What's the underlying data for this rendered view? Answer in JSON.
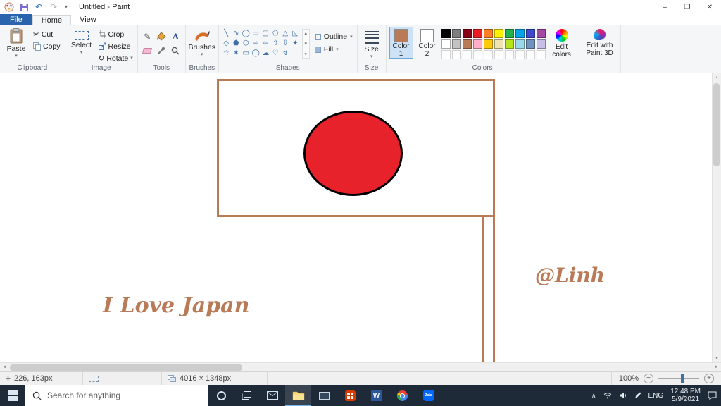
{
  "icons": {
    "undo": "↶",
    "redo": "↷",
    "dropdown": "▾",
    "minimize": "–",
    "restore": "❐",
    "close": "✕",
    "cut": "✂",
    "rotate": "↻",
    "pencil": "✎",
    "text_tool": "A",
    "crosshair": "+",
    "zoom_out": "−",
    "zoom_in": "+",
    "chevron_up": "∧",
    "scroll_up": "▴",
    "scroll_down": "▾",
    "scroll_left": "◄",
    "scroll_right": "►"
  },
  "window": {
    "title": "Untitled - Paint"
  },
  "tabs": {
    "file": "File",
    "home": "Home",
    "view": "View"
  },
  "ribbon": {
    "clipboard": {
      "group": "Clipboard",
      "paste": "Paste",
      "cut": "Cut",
      "copy": "Copy"
    },
    "image": {
      "group": "Image",
      "select": "Select",
      "crop": "Crop",
      "resize": "Resize",
      "rotate": "Rotate"
    },
    "tools": {
      "group": "Tools"
    },
    "brushes": {
      "group": "Brushes",
      "label": "Brushes"
    },
    "shapes": {
      "group": "Shapes",
      "outline": "Outline",
      "fill": "Fill",
      "items": [
        {
          "name": "line",
          "glyph": "╲"
        },
        {
          "name": "curve",
          "glyph": "∿"
        },
        {
          "name": "oval",
          "glyph": "◯"
        },
        {
          "name": "rectangle",
          "glyph": "▭"
        },
        {
          "name": "rounded-rectangle",
          "glyph": "▢"
        },
        {
          "name": "polygon",
          "glyph": "⬠"
        },
        {
          "name": "triangle",
          "glyph": "△"
        },
        {
          "name": "right-triangle",
          "glyph": "◺"
        },
        {
          "name": "diamond",
          "glyph": "◇"
        },
        {
          "name": "pentagon",
          "glyph": "⬟"
        },
        {
          "name": "hexagon",
          "glyph": "⬡"
        },
        {
          "name": "arrow-right",
          "glyph": "⇨"
        },
        {
          "name": "arrow-left",
          "glyph": "⇦"
        },
        {
          "name": "arrow-up",
          "glyph": "⇧"
        },
        {
          "name": "arrow-down",
          "glyph": "⇩"
        },
        {
          "name": "star-4",
          "glyph": "✦"
        },
        {
          "name": "star-5",
          "glyph": "☆"
        },
        {
          "name": "star-6",
          "glyph": "✶"
        },
        {
          "name": "callout-rounded",
          "glyph": "▭"
        },
        {
          "name": "callout-oval",
          "glyph": "◯"
        },
        {
          "name": "callout-cloud",
          "glyph": "☁"
        },
        {
          "name": "heart",
          "glyph": "♡"
        },
        {
          "name": "lightning",
          "glyph": "↯"
        }
      ]
    },
    "size": {
      "group": "Size",
      "label": "Size"
    },
    "colors": {
      "group": "Colors",
      "color1_label": "Color 1",
      "color2_label": "Color 2",
      "color1": "#B97A57",
      "color2": "#FFFFFF",
      "edit_colors": "Edit colors",
      "edit_3d": "Edit with Paint 3D",
      "row1": [
        "#000000",
        "#7F7F7F",
        "#880015",
        "#ED1C24",
        "#FF7F27",
        "#FFF200",
        "#22B14C",
        "#00A2E8",
        "#3F48CC",
        "#A349A4"
      ],
      "row2": [
        "#FFFFFF",
        "#C3C3C3",
        "#B97A57",
        "#FFAEC9",
        "#FFC90E",
        "#EFE4B0",
        "#B5E61D",
        "#99D9EA",
        "#7092BE",
        "#C8BFE7"
      ],
      "custom_slots": 10
    }
  },
  "canvas": {
    "flag_border": "#B97A57",
    "sun_fill": "#E8222A",
    "sun_stroke": "#000000",
    "text_color": "#B97A57",
    "caption": "I Love Japan",
    "signature": "@Linh"
  },
  "status": {
    "coords": "226, 163px",
    "dimensions": "4016 × 1348px",
    "zoom": "100%"
  },
  "taskbar": {
    "search_placeholder": "Search for anything",
    "word_letter": "W",
    "zalo_label": "Zalo",
    "lang": "ENG",
    "time": "12:48 PM",
    "date": "5/9/2021"
  }
}
